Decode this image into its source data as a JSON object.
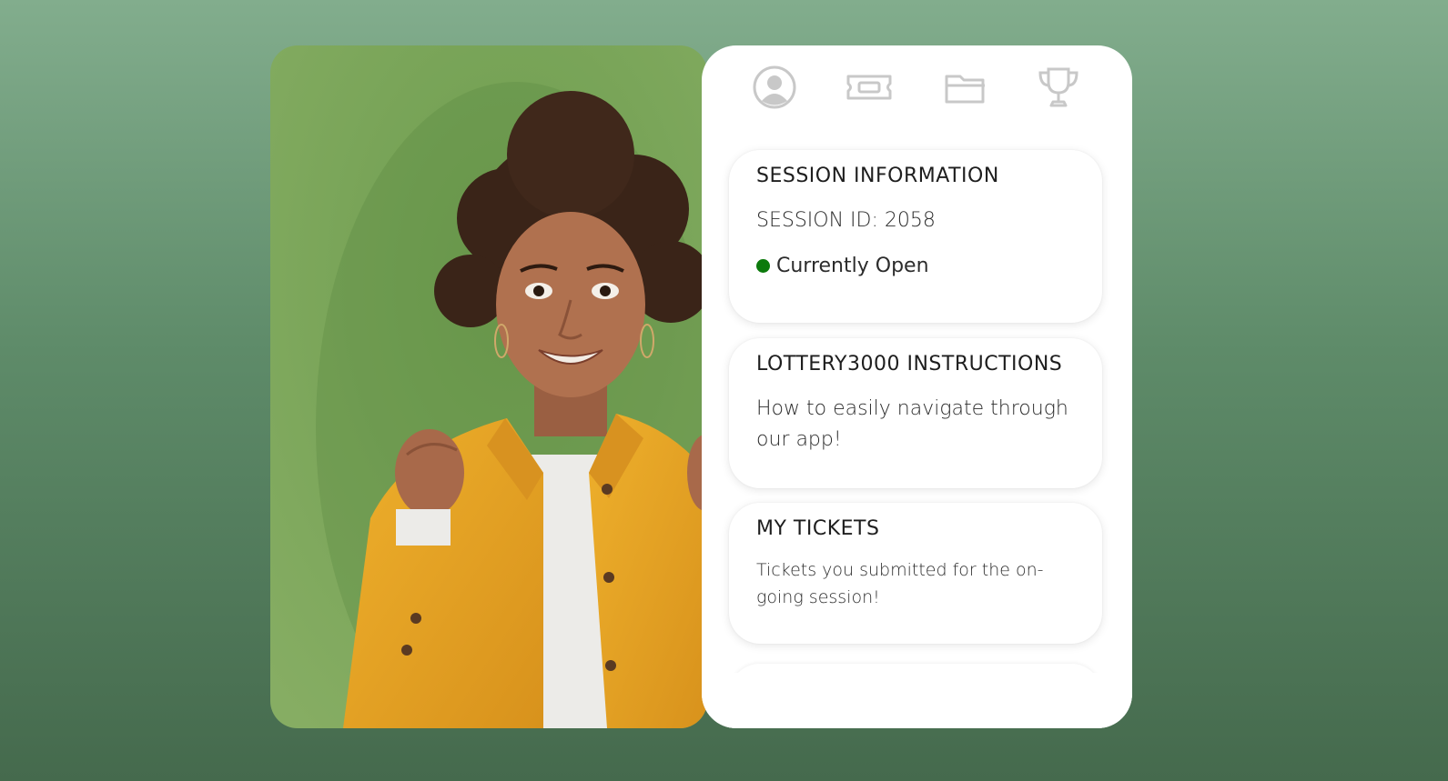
{
  "nav": {
    "icons": [
      "user-profile-icon",
      "ticket-icon",
      "folder-icon",
      "trophy-icon"
    ],
    "icon_color": "#c8c8c8"
  },
  "cards": {
    "session": {
      "title": "SESSION INFORMATION",
      "session_id": "SESSION ID: 2058",
      "status": "Currently Open",
      "status_color": "#0c7a0c"
    },
    "instructions": {
      "title": "LOTTERY3000 INSTRUCTIONS",
      "text": "How to easily navigate through our app!"
    },
    "tickets": {
      "title": "MY TICKETS",
      "text": "Tickets you submitted for the on-going session!"
    }
  },
  "colors": {
    "background_top": "#82ad8d",
    "background_bottom": "#456a4d",
    "panel": "#ffffff",
    "photo_backdrop": "#7aa65a",
    "jacket": "#e5a424"
  }
}
